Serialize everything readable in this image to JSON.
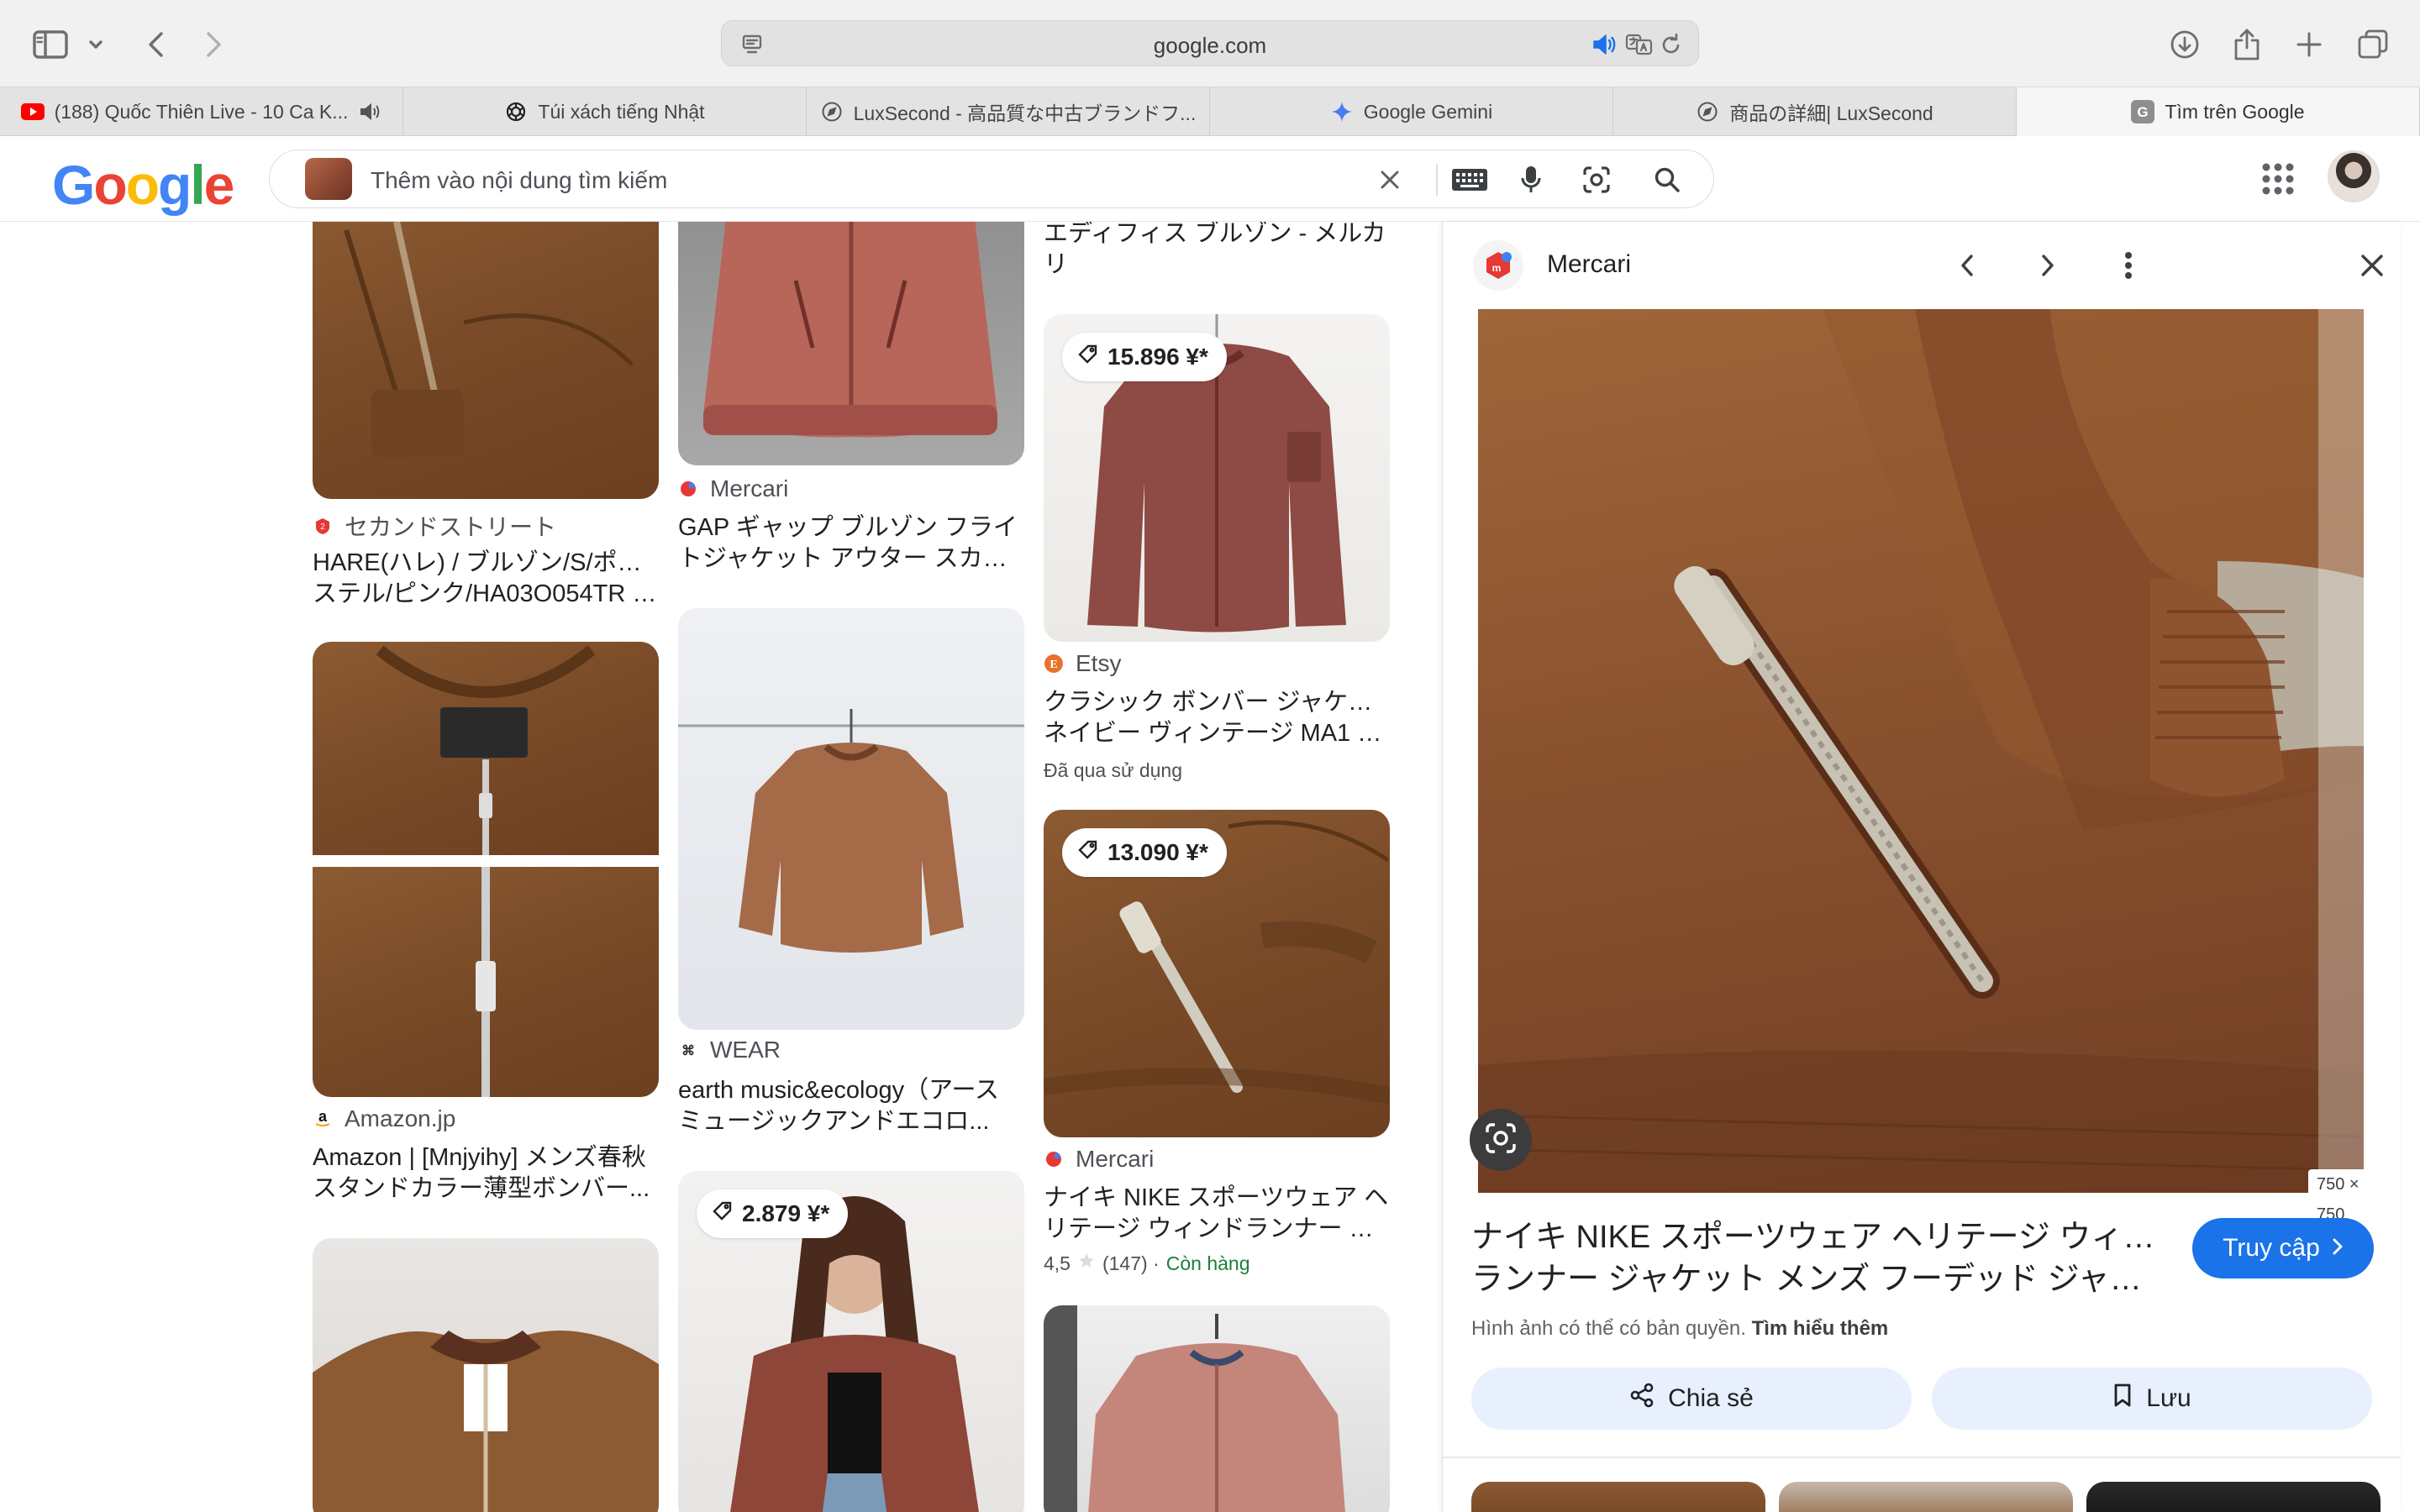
{
  "browser": {
    "url": "google.com",
    "tabs": [
      {
        "label": "(188) Quốc Thiên Live - 10 Ca K...",
        "favicon": "youtube-icon"
      },
      {
        "label": "Túi xách tiếng Nhật",
        "favicon": "openai-icon"
      },
      {
        "label": "LuxSecond - 高品質な中古ブランドフ...",
        "favicon": "compass-icon"
      },
      {
        "label": "Google Gemini",
        "favicon": "gemini-icon"
      },
      {
        "label": "商品の詳細| LuxSecond",
        "favicon": "compass-icon"
      },
      {
        "label": "Tìm trên Google",
        "favicon": "google-g-icon"
      }
    ]
  },
  "header": {
    "logo": "Google",
    "search_placeholder": "Thêm vào nội dung tìm kiếm"
  },
  "results": [
    {
      "source": "セカンドストリート",
      "title_l1": "HARE(ハレ) / ブルゾン/S/ポリエ",
      "title_l2": "ステル/ピンク/HA03O054TR | ..."
    },
    {
      "source": "Amazon.jp",
      "title_l1": "Amazon | [Mnjyihy] メンズ春秋",
      "title_l2": "スタンドカラー薄型ボンバー..."
    },
    {
      "source": "Mercari",
      "title_l1": "GAP ギャップ ブルゾン フライ",
      "title_l2": "トジャケット アウター スカジ..."
    },
    {
      "source": "WEAR",
      "title_l1": "earth music&ecology（アース",
      "title_l2": "ミュージックアンドエコロ..."
    },
    {
      "price": "2.879 ¥*"
    },
    {
      "title_l1": "エディフィス ブルゾン - メルカ",
      "title_l2": "リ"
    },
    {
      "price": "15.896 ¥*",
      "source": "Etsy",
      "title_l1": "クラシック ボンバー ジャケット",
      "title_l2": "ネイビー ヴィンテージ MA1 オ...",
      "subtitle": "Đã qua sử dụng"
    },
    {
      "price": "13.090 ¥*",
      "source": "Mercari",
      "title_l1": "ナイキ NIKE スポーツウェア ヘ",
      "title_l2": "リテージ ウィンドランナー ジ...",
      "rating": "4,5",
      "reviews": "(147) ·",
      "stock": "Còn hàng"
    }
  ],
  "panel": {
    "source": "Mercari",
    "image_dims": "750 × 750",
    "title_l1": "ナイキ NIKE スポーツウェア ヘリテージ ウィンド",
    "title_l2": "ランナー ジャケット メンズ フーデッド ジャケッ...",
    "visit_label": "Truy cập",
    "copyright_text": "Hình ảnh có thể có bản quyền.",
    "learn_more": "Tìm hiểu thêm",
    "share_label": "Chia sẻ",
    "save_label": "Lưu"
  },
  "colors": {
    "accent": "#1a73e8",
    "pill": "#e8f0fe",
    "stock_green": "#188038"
  }
}
